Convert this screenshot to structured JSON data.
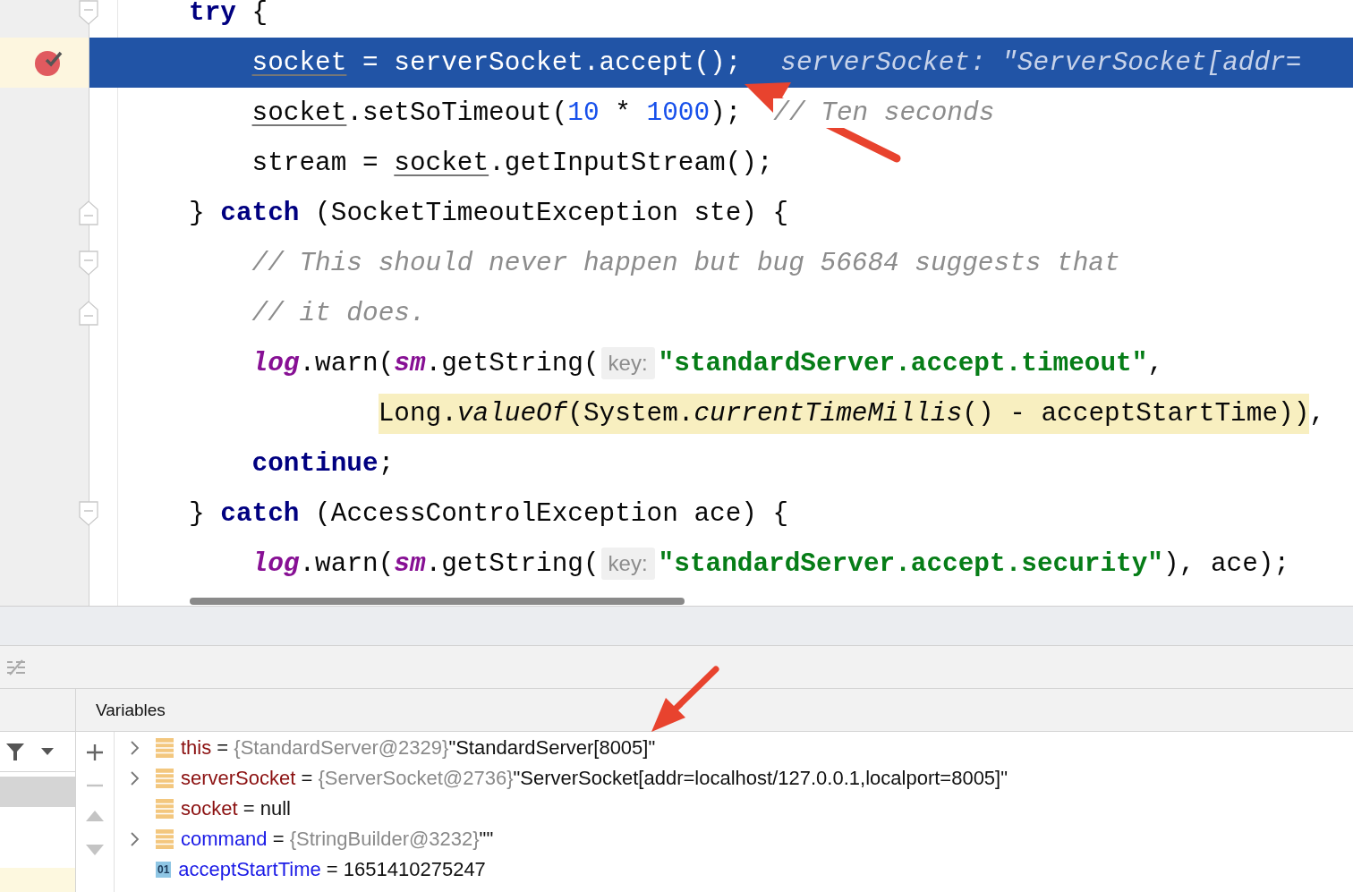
{
  "editor": {
    "lines": [
      {
        "current": false,
        "breakpoint": false,
        "fold_open": true,
        "fold_close": false,
        "tokens": [
          {
            "t": "try",
            "kind": "keyword"
          },
          {
            "t": " {",
            "kind": "plain"
          }
        ]
      },
      {
        "current": true,
        "breakpoint": true,
        "fold_open": false,
        "fold_close": false,
        "tokens": [
          {
            "t": "socket",
            "kind": "field"
          },
          {
            "t": " = serverSocket.accept();",
            "kind": "plain"
          },
          {
            "t": "serverSocket: \"ServerSocket[addr=",
            "kind": "inline"
          }
        ]
      },
      {
        "current": false,
        "breakpoint": false,
        "fold_open": false,
        "fold_close": false,
        "tokens": [
          {
            "t": "socket",
            "kind": "field"
          },
          {
            "t": ".setSoTimeout(",
            "kind": "plain"
          },
          {
            "t": "10",
            "kind": "number"
          },
          {
            "t": " * ",
            "kind": "plain"
          },
          {
            "t": "1000",
            "kind": "number"
          },
          {
            "t": ");",
            "kind": "plain"
          },
          {
            "t": "// Ten seconds",
            "kind": "comment"
          }
        ]
      },
      {
        "current": false,
        "breakpoint": false,
        "fold_open": false,
        "fold_close": false,
        "tokens": [
          {
            "t": "stream = ",
            "kind": "plain"
          },
          {
            "t": "socket",
            "kind": "field"
          },
          {
            "t": ".getInputStream();",
            "kind": "plain"
          }
        ]
      },
      {
        "current": false,
        "breakpoint": false,
        "fold_open": false,
        "fold_close": true,
        "tokens": [
          {
            "t": "} ",
            "kind": "plain"
          },
          {
            "t": "catch",
            "kind": "keyword"
          },
          {
            "t": " (SocketTimeoutException ste) {",
            "kind": "plain"
          }
        ]
      },
      {
        "current": false,
        "breakpoint": false,
        "fold_open": true,
        "fold_close": false,
        "tokens": [
          {
            "t": "// This should never happen but bug 56684 suggests that",
            "kind": "comment"
          }
        ]
      },
      {
        "current": false,
        "breakpoint": false,
        "fold_open": false,
        "fold_close": true,
        "tokens": [
          {
            "t": "// it does.",
            "kind": "comment"
          }
        ]
      },
      {
        "current": false,
        "breakpoint": false,
        "fold_open": false,
        "fold_close": false,
        "tokens": [
          {
            "t": "log",
            "kind": "static"
          },
          {
            "t": ".warn(",
            "kind": "plain"
          },
          {
            "t": "sm",
            "kind": "static"
          },
          {
            "t": ".getString(",
            "kind": "plain"
          },
          {
            "t": "key:",
            "kind": "hint"
          },
          {
            "t": "\"standardServer.accept.timeout\"",
            "kind": "string"
          },
          {
            "t": ",",
            "kind": "plain"
          }
        ]
      },
      {
        "current": false,
        "breakpoint": false,
        "fold_open": false,
        "fold_close": false,
        "tokens": [
          {
            "t": "Long.",
            "kind": "plain",
            "marked": true
          },
          {
            "t": "valueOf",
            "kind": "italic",
            "marked": true
          },
          {
            "t": "(System.",
            "kind": "plain",
            "marked": true
          },
          {
            "t": "currentTimeMillis",
            "kind": "italic",
            "marked": true
          },
          {
            "t": "() - acceptStartTime))",
            "kind": "plain",
            "marked": true
          },
          {
            "t": ",",
            "kind": "plain",
            "marked": false
          }
        ]
      },
      {
        "current": false,
        "breakpoint": false,
        "fold_open": false,
        "fold_close": false,
        "tokens": [
          {
            "t": "continue",
            "kind": "keyword"
          },
          {
            "t": ";",
            "kind": "plain"
          }
        ]
      },
      {
        "current": false,
        "breakpoint": false,
        "fold_open": true,
        "fold_close": false,
        "tokens": [
          {
            "t": "} ",
            "kind": "plain"
          },
          {
            "t": "catch",
            "kind": "keyword"
          },
          {
            "t": " (AccessControlException ace) {",
            "kind": "plain"
          }
        ]
      },
      {
        "current": false,
        "breakpoint": false,
        "fold_open": false,
        "fold_close": false,
        "tokens": [
          {
            "t": "log",
            "kind": "static"
          },
          {
            "t": ".warn(",
            "kind": "plain"
          },
          {
            "t": "sm",
            "kind": "static"
          },
          {
            "t": ".getString(",
            "kind": "plain"
          },
          {
            "t": "key:",
            "kind": "hint"
          },
          {
            "t": "\"standardServer.accept.security\"",
            "kind": "string"
          },
          {
            "t": "), ace);",
            "kind": "plain"
          }
        ]
      }
    ]
  },
  "variables": {
    "title": "Variables",
    "rows": [
      {
        "expandable": true,
        "kind": "local",
        "name": "this",
        "separator": "=",
        "type": "{StandardServer@2329}",
        "value": "\"StandardServer[8005]\""
      },
      {
        "expandable": true,
        "kind": "local",
        "name": "serverSocket",
        "separator": "=",
        "type": "{ServerSocket@2736}",
        "value": "\"ServerSocket[addr=localhost/127.0.0.1,localport=8005]\""
      },
      {
        "expandable": false,
        "kind": "local",
        "name": "socket",
        "separator": "=",
        "value": "null"
      },
      {
        "expandable": true,
        "kind": "field",
        "name": "command",
        "separator": "=",
        "type": "{StringBuilder@3232}",
        "value": "\"\""
      },
      {
        "expandable": false,
        "kind": "primitive",
        "icon_text": "01",
        "name": "acceptStartTime",
        "separator": "=",
        "value": "1651410275247"
      }
    ]
  }
}
